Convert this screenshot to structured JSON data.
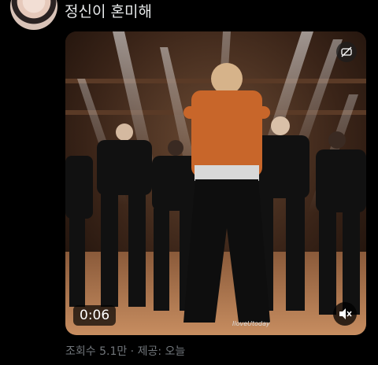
{
  "tweet": {
    "text": "정신이 혼미해"
  },
  "video": {
    "elapsed": "0:06",
    "watermark": "IloveUtoday",
    "hide_icon": "eye-slash-icon",
    "mute_icon": "speaker-muted-icon"
  },
  "meta": {
    "views_label": "조회수 5.1만 · 제공: 오늘"
  },
  "colors": {
    "background": "#000000",
    "text_primary": "#e7e9ea",
    "text_secondary": "#71767b",
    "shirt_orange": "#c8662a"
  }
}
